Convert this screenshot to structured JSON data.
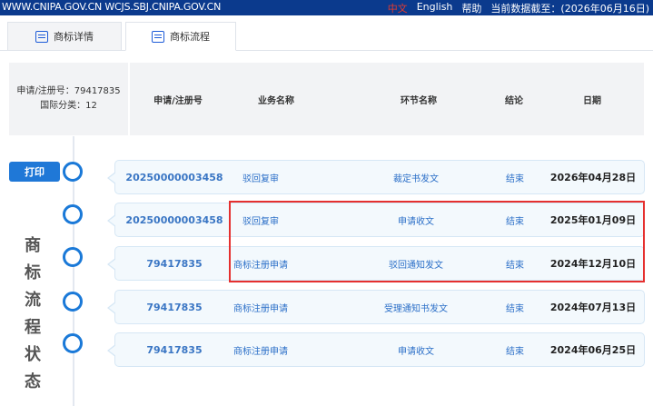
{
  "topbar": {
    "url": "WWW.CNIPA.GOV.CN WCJS.SBJ.CNIPA.GOV.CN",
    "lang_cn": "中文",
    "lang_en": "English",
    "help": "帮助",
    "data_date": "当前数据截至：(2026年06月16日)"
  },
  "tabs": [
    {
      "label": "商标详情",
      "icon": "document-icon"
    },
    {
      "label": "商标流程",
      "icon": "list-icon"
    }
  ],
  "info": {
    "reg_no": "申请/注册号：79417835",
    "class": "国际分类：12"
  },
  "columns": [
    "申请/注册号",
    "业务名称",
    "环节名称",
    "结论",
    "日期"
  ],
  "print_label": "打印",
  "vertical_title": [
    "商",
    "标",
    "流",
    "程",
    "状",
    "态"
  ],
  "rows": [
    {
      "no": "20250000003458",
      "business": "驳回复审",
      "step": "裁定书发文",
      "result": "结束",
      "date": "2026年04月28日"
    },
    {
      "no": "20250000003458",
      "business": "驳回复审",
      "step": "申请收文",
      "result": "结束",
      "date": "2025年01月09日"
    },
    {
      "no": "79417835",
      "business": "商标注册申请",
      "step": "驳回通知发文",
      "result": "结束",
      "date": "2024年12月10日"
    },
    {
      "no": "79417835",
      "business": "商标注册申请",
      "step": "受理通知书发文",
      "result": "结束",
      "date": "2024年07月13日"
    },
    {
      "no": "79417835",
      "business": "商标注册申请",
      "step": "申请收文",
      "result": "结束",
      "date": "2024年06月25日"
    }
  ],
  "colors": {
    "topbar": "#0b3a8d",
    "accent": "#1f78d7",
    "highlight": "#e5302f"
  }
}
